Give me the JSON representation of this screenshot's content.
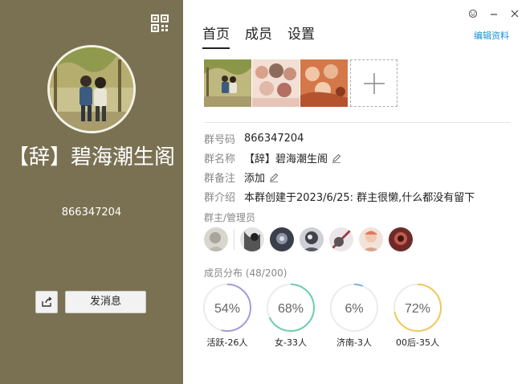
{
  "left": {
    "group_name": "【辞】碧海潮生阁",
    "group_number": "866347204",
    "send_message_label": "发消息"
  },
  "tabs": [
    {
      "label": "首页",
      "active": true
    },
    {
      "label": "成员",
      "active": false
    },
    {
      "label": "设置",
      "active": false
    }
  ],
  "edit_profile_label": "编辑资料",
  "info": {
    "number_label": "群号码",
    "number_value": "866347204",
    "name_label": "群名称",
    "name_value": "【辞】碧海潮生阁",
    "note_label": "群备注",
    "note_value": "添加",
    "intro_label": "群介绍",
    "intro_value": "本群创建于2023/6/25: 群主很懒,什么都没有留下"
  },
  "admins_title": "群主/管理员",
  "distribution": {
    "title": "成员分布",
    "count": "(48/200)",
    "stats": [
      {
        "percent_text": "54%",
        "fraction": 0.54,
        "label": "活跃-26人",
        "color": "#a99ad9"
      },
      {
        "percent_text": "68%",
        "fraction": 0.68,
        "label": "女-33人",
        "color": "#6ccfa8"
      },
      {
        "percent_text": "6%",
        "fraction": 0.06,
        "label": "济南-3人",
        "color": "#7ab4e8"
      },
      {
        "percent_text": "72%",
        "fraction": 0.72,
        "label": "00后-35人",
        "color": "#f0c95c"
      }
    ]
  },
  "colors": {
    "left_bg": "#7a7152",
    "link": "#1a8fd6"
  }
}
